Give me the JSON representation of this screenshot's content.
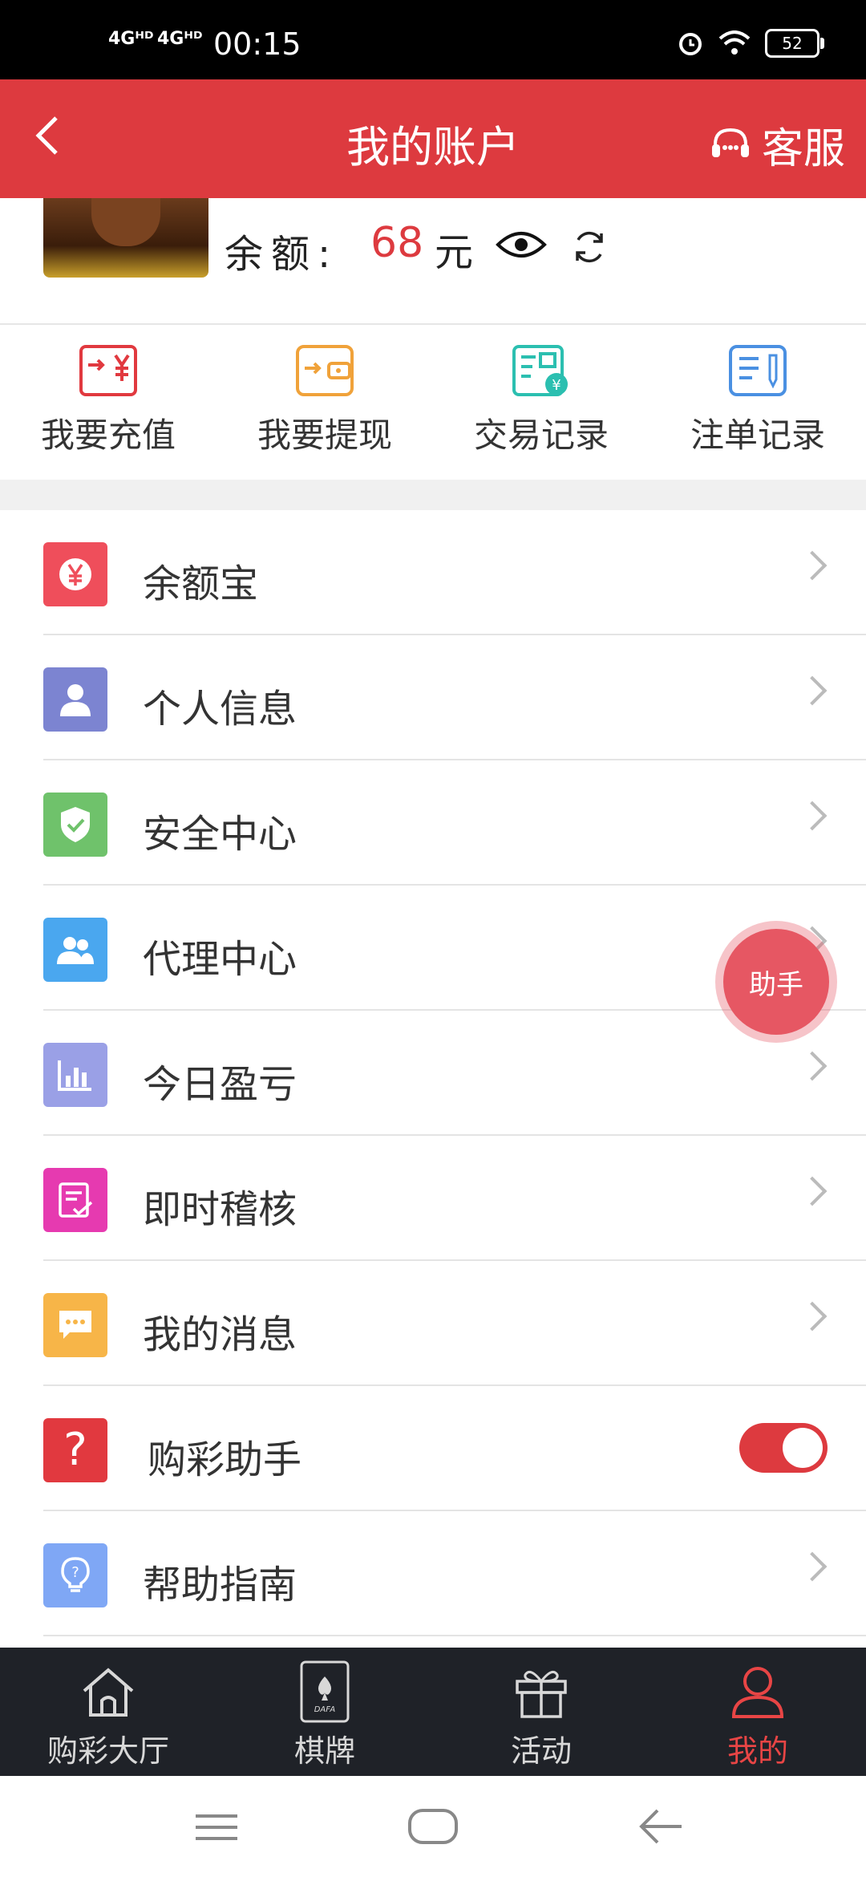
{
  "status_bar": {
    "signal1": "4Gᴴᴰ",
    "signal2": "4Gᴴᴰ",
    "time": "00:15",
    "battery": "52"
  },
  "header": {
    "title": "我的账户",
    "service_label": "客服"
  },
  "balance": {
    "label": "余额:",
    "amount": "68",
    "unit": "元"
  },
  "actions": [
    {
      "label": "我要充值",
      "icon": "recharge-icon",
      "color": "#e1393f"
    },
    {
      "label": "我要提现",
      "icon": "withdraw-wallet-icon",
      "color": "#f0a23a"
    },
    {
      "label": "交易记录",
      "icon": "transaction-record-icon",
      "color": "#2bbfb0"
    },
    {
      "label": "注单记录",
      "icon": "bet-record-icon",
      "color": "#4a90e2"
    }
  ],
  "menu": [
    {
      "label": "余额宝",
      "icon": "yen-icon",
      "color": "#ef4e5b"
    },
    {
      "label": "个人信息",
      "icon": "person-icon",
      "color": "#7c84d1"
    },
    {
      "label": "安全中心",
      "icon": "shield-icon",
      "color": "#6fc26b"
    },
    {
      "label": "代理中心",
      "icon": "group-icon",
      "color": "#4aa7ef"
    },
    {
      "label": "今日盈亏",
      "icon": "bar-chart-icon",
      "color": "#9aa0e6"
    },
    {
      "label": "即时稽核",
      "icon": "checklist-icon",
      "color": "#e63ab0"
    },
    {
      "label": "我的消息",
      "icon": "message-icon",
      "color": "#f7b548"
    },
    {
      "label": "购彩助手",
      "icon": "question-icon",
      "color": "#e1393f",
      "toggle": true
    },
    {
      "label": "帮助指南",
      "icon": "lightbulb-icon",
      "color": "#7fa7f5"
    }
  ],
  "helper": {
    "label": "助手"
  },
  "tabs": [
    {
      "label": "购彩大厅",
      "icon": "home-icon"
    },
    {
      "label": "棋牌",
      "icon": "poker-card-icon",
      "card_text": "DAFA"
    },
    {
      "label": "活动",
      "icon": "gift-icon"
    },
    {
      "label": "我的",
      "icon": "user-icon",
      "active": true
    }
  ],
  "colors": {
    "brand": "#dd3a3f",
    "tabbar": "#1f2228"
  }
}
